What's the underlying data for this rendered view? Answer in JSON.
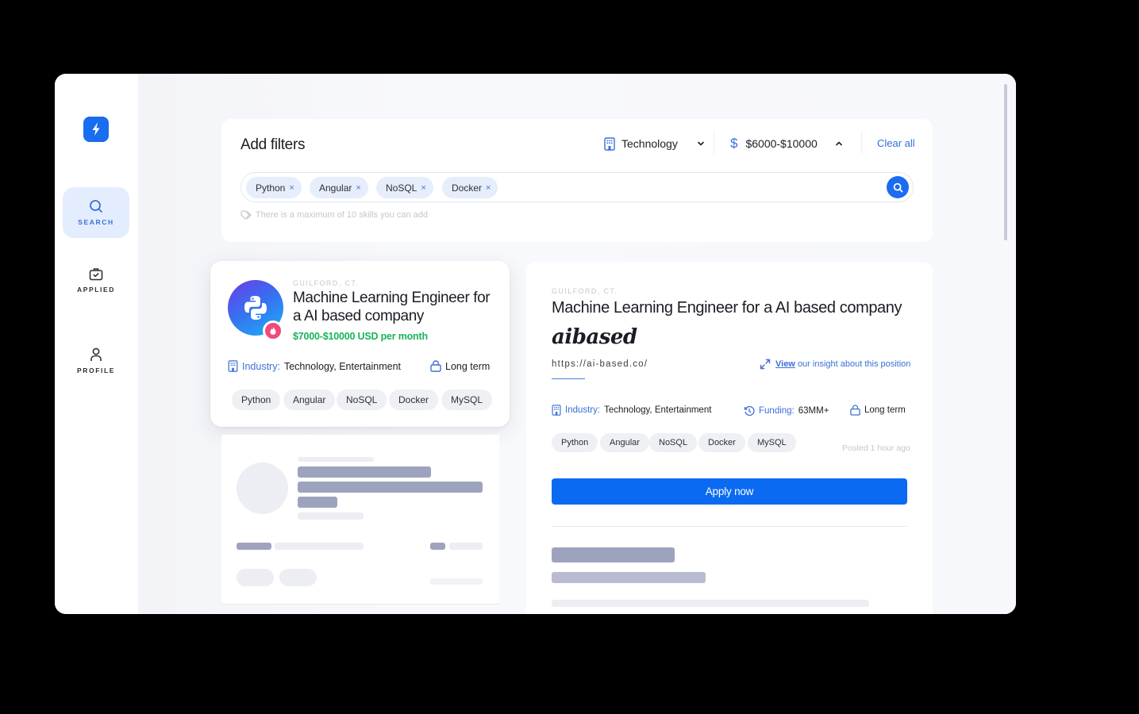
{
  "sidebar": {
    "logo_icon": "lightning-bolt-icon",
    "items": [
      {
        "label": "SEARCH",
        "icon": "search-icon",
        "active": true
      },
      {
        "label": "APPLIED",
        "icon": "briefcase-check-icon",
        "active": false
      },
      {
        "label": "PROFILE",
        "icon": "user-icon",
        "active": false
      }
    ]
  },
  "filters": {
    "title": "Add filters",
    "industry": {
      "icon": "building-icon",
      "value": "Technology",
      "chevron": "chevron-down-icon"
    },
    "salary": {
      "icon": "dollar-icon",
      "value": "$6000-$10000",
      "chevron": "chevron-up-icon"
    },
    "clear_all": "Clear all",
    "chips": [
      {
        "label": "Python",
        "remove": "×"
      },
      {
        "label": "Angular",
        "remove": "×"
      },
      {
        "label": "NoSQL",
        "remove": "×"
      },
      {
        "label": "Docker",
        "remove": "×"
      }
    ],
    "hint": "There is a maximum of 10 skills you can add"
  },
  "job_card": {
    "location": "GUILFORD, CT.",
    "title": "Machine Learning Engineer for a AI based company",
    "salary": "$7000-$10000 USD per month",
    "industry_key": "Industry:",
    "industry_value": "Technology, Entertainment",
    "term": "Long term",
    "tags": [
      "Python",
      "Angular",
      "NoSQL",
      "Docker",
      "MySQL"
    ]
  },
  "detail": {
    "location": "GUILFORD, CT.",
    "title": "Machine Learning Engineer for a AI based company",
    "company_logo": "aibased",
    "url": "https://ai-based.co/",
    "insight_link": "View",
    "insight_text": "our insight about this position",
    "industry_key": "Industry:",
    "industry_value": "Technology, Entertainment",
    "funding_key": "Funding:",
    "funding_value": "63MM+",
    "term": "Long term",
    "tags": [
      "Python",
      "Angular",
      "NoSQL",
      "Docker",
      "MySQL"
    ],
    "posted": "Posted 1 hour ago",
    "apply_label": "Apply now"
  }
}
